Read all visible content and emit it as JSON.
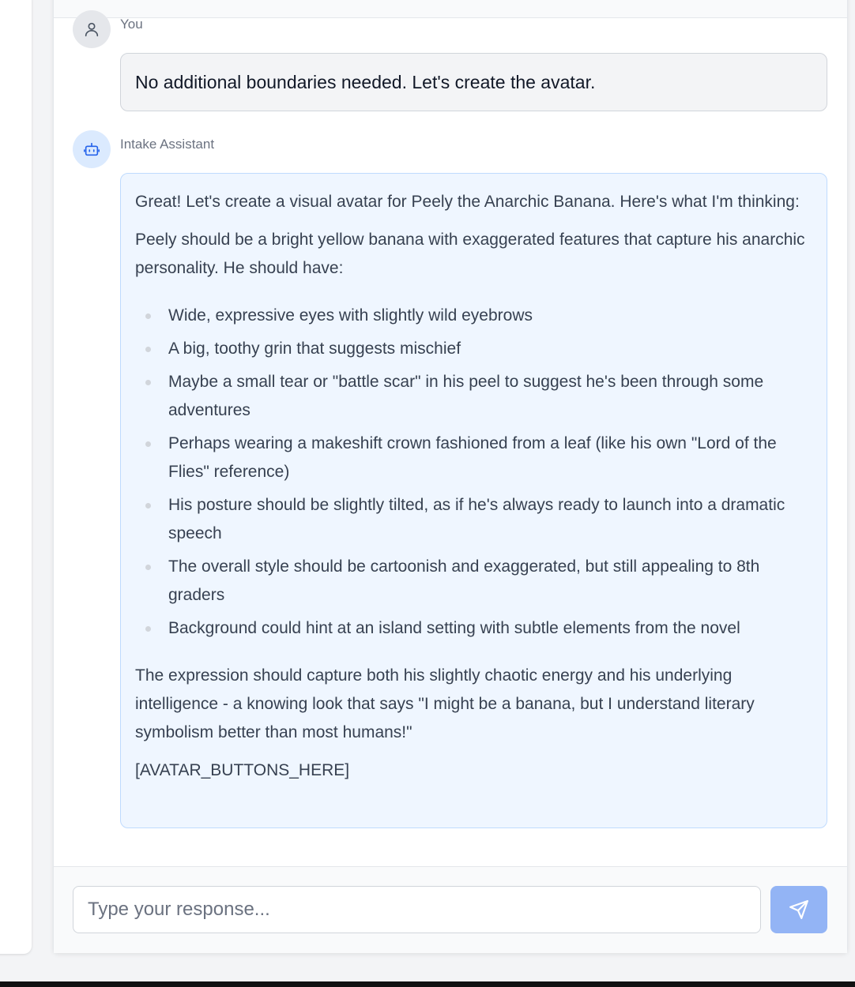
{
  "messages": [
    {
      "sender": "You",
      "role": "user",
      "text": "No additional boundaries needed. Let's create the avatar."
    },
    {
      "sender": "Intake Assistant",
      "role": "assistant",
      "paragraphs_before": [
        "Great! Let's create a visual avatar for Peely the Anarchic Banana. Here's what I'm thinking:",
        "Peely should be a bright yellow banana with exaggerated features that capture his anarchic personality. He should have:"
      ],
      "bullets": [
        "Wide, expressive eyes with slightly wild eyebrows",
        "A big, toothy grin that suggests mischief",
        "Maybe a small tear or \"battle scar\" in his peel to suggest he's been through some adventures",
        "Perhaps wearing a makeshift crown fashioned from a leaf (like his own \"Lord of the Flies\" reference)",
        "His posture should be slightly tilted, as if he's always ready to launch into a dramatic speech",
        "The overall style should be cartoonish and exaggerated, but still appealing to 8th graders",
        "Background could hint at an island setting with subtle elements from the novel"
      ],
      "paragraphs_after": [
        "The expression should capture both his slightly chaotic energy and his underlying intelligence - a knowing look that says \"I might be a banana, but I understand literary symbolism better than most humans!\"",
        "[AVATAR_BUTTONS_HERE]"
      ]
    }
  ],
  "composer": {
    "placeholder": "Type your response...",
    "value": "",
    "send_icon": "send-icon"
  },
  "icons": {
    "user_avatar": "user-icon",
    "bot_avatar": "robot-icon"
  },
  "colors": {
    "accent": "#2563eb",
    "send_button": "#93b4f5",
    "assistant_bubble": "#eff6ff",
    "user_bubble": "#f3f4f6"
  }
}
